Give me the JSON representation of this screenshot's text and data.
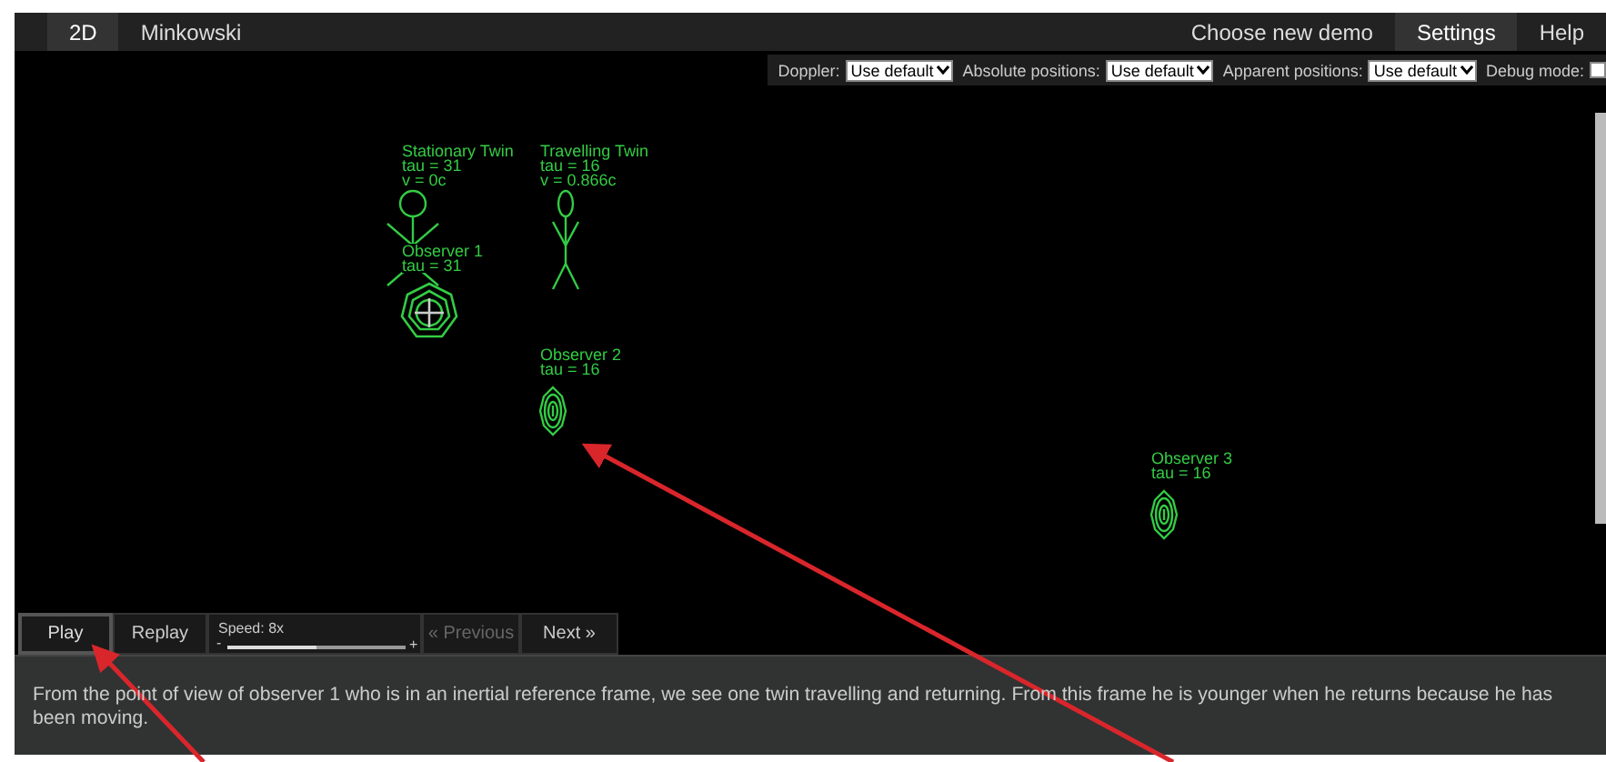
{
  "nav": {
    "left": [
      {
        "label": "2D",
        "selected": true
      },
      {
        "label": "Minkowski",
        "selected": false
      }
    ],
    "right": [
      {
        "label": "Choose new demo",
        "selected": false
      },
      {
        "label": "Settings",
        "selected": true
      },
      {
        "label": "Help",
        "selected": false
      }
    ]
  },
  "settings": {
    "fields": [
      {
        "label": "Doppler:",
        "value": "Use default"
      },
      {
        "label": "Absolute positions:",
        "value": "Use default"
      },
      {
        "label": "Apparent positions:",
        "value": "Use default"
      }
    ],
    "debug": {
      "label": "Debug mode:",
      "checked": false
    }
  },
  "scene": {
    "objects": [
      {
        "kind": "person",
        "lines": [
          "Stationary Twin",
          "tau = 31",
          "v = 0c"
        ]
      },
      {
        "kind": "person",
        "lines": [
          "Travelling Twin",
          "tau = 16",
          "v = 0.866c"
        ]
      },
      {
        "kind": "observer",
        "lines": [
          "Observer 1",
          "tau = 31"
        ]
      },
      {
        "kind": "observer",
        "lines": [
          "Observer 2",
          "tau = 16"
        ]
      },
      {
        "kind": "observer",
        "lines": [
          "Observer 3",
          "tau = 16"
        ]
      }
    ]
  },
  "controls": {
    "buttons": [
      {
        "label": "Play",
        "selected": true,
        "disabled": false
      },
      {
        "label": "Replay",
        "selected": false,
        "disabled": false
      }
    ],
    "speed": {
      "label": "Speed: 8x",
      "minus": "-",
      "plus": "+",
      "level": 0.5
    },
    "steps": [
      {
        "label": "« Previous",
        "disabled": true
      },
      {
        "label": "Next »",
        "disabled": false
      }
    ]
  },
  "description": "From the point of view of observer 1 who is in an inertial reference frame, we see one twin travelling and returning. From this frame he is younger when he returns because he has been moving."
}
